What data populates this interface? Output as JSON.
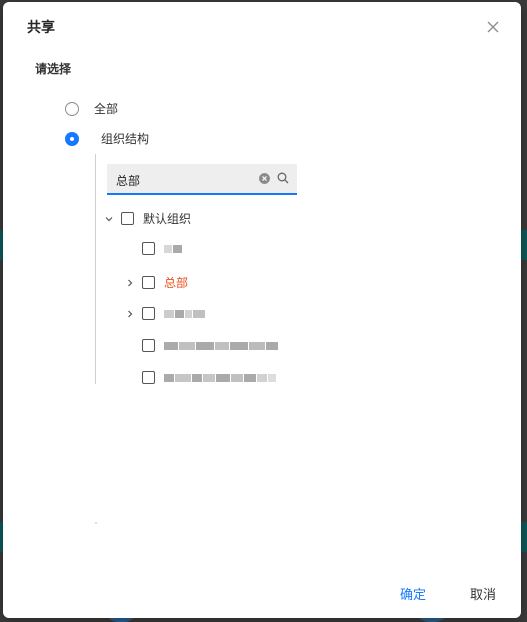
{
  "dialog": {
    "title": "共享",
    "section_label": "请选择",
    "close_icon": "close-icon"
  },
  "scope": {
    "options": [
      {
        "label": "全部",
        "checked": false
      },
      {
        "label": "组织结构",
        "checked": true
      }
    ],
    "accent_color": "#1677ff"
  },
  "search": {
    "value": "总部",
    "clear_icon": "clear-icon",
    "search_icon": "search-icon"
  },
  "tree": {
    "root": {
      "label": "默认组织",
      "expanded": true
    },
    "children": [
      {
        "label": "",
        "expandable": false,
        "redacted": true
      },
      {
        "label": "总部",
        "expandable": true,
        "highlight": true,
        "highlight_color": "#e8501e"
      },
      {
        "label": "",
        "expandable": true,
        "redacted": true
      },
      {
        "label": "",
        "expandable": false,
        "redacted": true
      },
      {
        "label": "",
        "expandable": false,
        "redacted": true
      }
    ]
  },
  "footer": {
    "confirm_label": "确定",
    "cancel_label": "取消"
  }
}
